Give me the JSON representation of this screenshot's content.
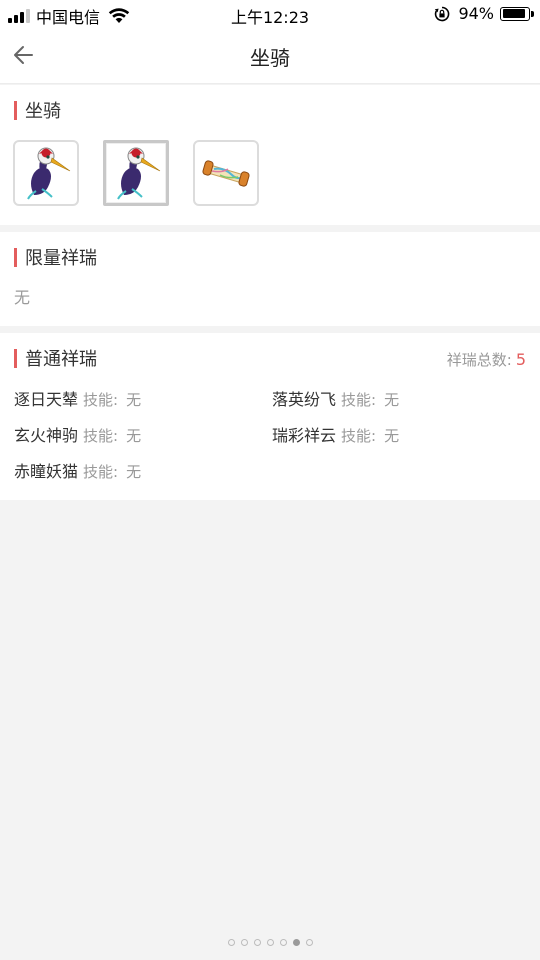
{
  "status": {
    "carrier": "中国电信",
    "time": "上午12:23",
    "battery": "94%",
    "battery_level": 0.94
  },
  "nav": {
    "title": "坐骑",
    "back_icon": "back-arrow-icon"
  },
  "mounts": {
    "title": "坐骑",
    "items": [
      {
        "icon": "crane-icon"
      },
      {
        "icon": "crane-icon",
        "selected": true
      },
      {
        "icon": "scroll-icon"
      }
    ]
  },
  "limited": {
    "title": "限量祥瑞",
    "empty_text": "无"
  },
  "normal": {
    "title": "普通祥瑞",
    "total_label": "祥瑞总数:",
    "total_value": "5",
    "skill_label": "技能:",
    "entries": [
      {
        "name": "逐日天辇",
        "skill": "无"
      },
      {
        "name": "落英纷飞",
        "skill": "无"
      },
      {
        "name": "玄火神驹",
        "skill": "无"
      },
      {
        "name": "瑞彩祥云",
        "skill": "无"
      },
      {
        "name": "赤瞳妖猫",
        "skill": "无"
      }
    ]
  },
  "pagination": {
    "count": 7,
    "active_index": 5
  },
  "colors": {
    "accent": "#e35d5d",
    "muted": "#999999",
    "background": "#f3f3f3"
  }
}
